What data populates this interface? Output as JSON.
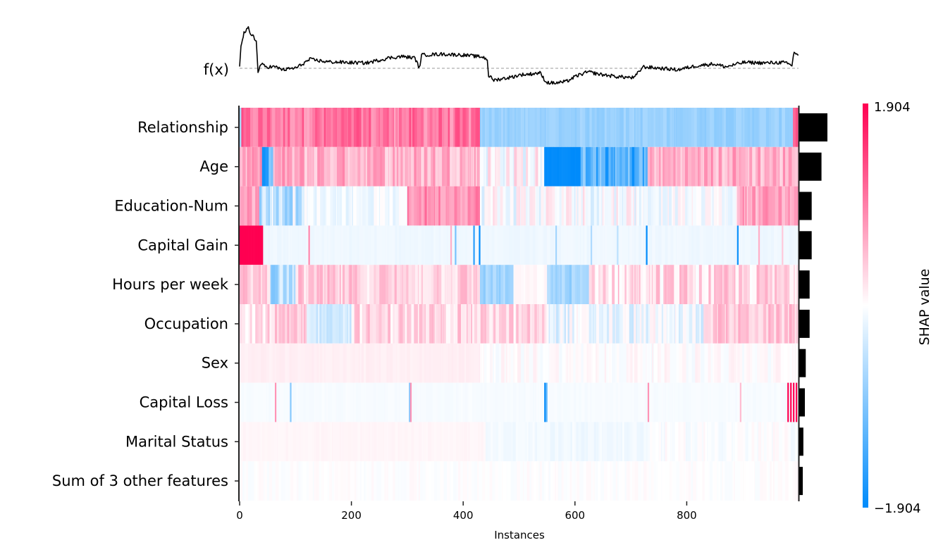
{
  "chart_data": {
    "type": "heatmap",
    "title": "",
    "xlabel": "Instances",
    "ylabel": "",
    "n_instances": 1000,
    "xlim": [
      0,
      1000
    ],
    "x_ticks": [
      0,
      200,
      400,
      600,
      800
    ],
    "fx_label": "f(x)",
    "colorbar": {
      "title": "SHAP value",
      "max_label": "1.904",
      "min_label": "−1.904",
      "vmin": -1.904,
      "vmax": 1.904,
      "low_color": "#008bfb",
      "mid_color": "#ffffff",
      "high_color": "#ff0051"
    },
    "features": [
      {
        "name": "Relationship",
        "mean_abs_shap": 0.95
      },
      {
        "name": "Age",
        "mean_abs_shap": 0.75
      },
      {
        "name": "Education-Num",
        "mean_abs_shap": 0.42
      },
      {
        "name": "Capital Gain",
        "mean_abs_shap": 0.42
      },
      {
        "name": "Hours per week",
        "mean_abs_shap": 0.35
      },
      {
        "name": "Occupation",
        "mean_abs_shap": 0.35
      },
      {
        "name": "Sex",
        "mean_abs_shap": 0.22
      },
      {
        "name": "Capital Loss",
        "mean_abs_shap": 0.19
      },
      {
        "name": "Marital Status",
        "mean_abs_shap": 0.14
      },
      {
        "name": "Sum of 3 other features",
        "mean_abs_shap": 0.12
      }
    ],
    "heatmap_segments": [
      [
        [
          0,
          3,
          -0.6,
          0.1
        ],
        [
          3,
          430,
          1.0,
          0.35
        ],
        [
          430,
          990,
          -0.75,
          0.12
        ],
        [
          990,
          1000,
          1.3,
          0.3
        ]
      ],
      [
        [
          0,
          40,
          0.6,
          0.35
        ],
        [
          40,
          60,
          -1.2,
          0.6
        ],
        [
          60,
          430,
          0.6,
          0.35
        ],
        [
          430,
          545,
          0.05,
          0.4
        ],
        [
          545,
          610,
          -1.9,
          0.05
        ],
        [
          610,
          730,
          -1.3,
          0.6
        ],
        [
          730,
          1000,
          0.6,
          0.35
        ]
      ],
      [
        [
          0,
          35,
          0.7,
          0.3
        ],
        [
          35,
          120,
          -0.4,
          0.5
        ],
        [
          120,
          300,
          -0.1,
          0.15
        ],
        [
          300,
          430,
          0.85,
          0.3
        ],
        [
          430,
          720,
          0.0,
          0.35
        ],
        [
          720,
          890,
          -0.05,
          0.2
        ],
        [
          890,
          1000,
          0.7,
          0.3
        ]
      ],
      [
        [
          0,
          42,
          1.904,
          0.0
        ],
        [
          42,
          1000,
          -0.12,
          0.03
        ]
      ],
      [
        [
          0,
          55,
          0.4,
          0.25
        ],
        [
          55,
          100,
          -0.6,
          0.4
        ],
        [
          100,
          430,
          0.35,
          0.3
        ],
        [
          430,
          490,
          -0.7,
          0.2
        ],
        [
          490,
          550,
          0.05,
          0.05
        ],
        [
          550,
          625,
          -0.7,
          0.2
        ],
        [
          625,
          1000,
          0.3,
          0.35
        ]
      ],
      [
        [
          0,
          120,
          0.3,
          0.3
        ],
        [
          120,
          200,
          -0.3,
          0.2
        ],
        [
          200,
          550,
          0.3,
          0.3
        ],
        [
          550,
          830,
          -0.15,
          0.3
        ],
        [
          830,
          1000,
          0.4,
          0.25
        ]
      ],
      [
        [
          0,
          430,
          0.12,
          0.03
        ],
        [
          430,
          1000,
          0.02,
          0.12
        ]
      ],
      [
        [
          0,
          1000,
          -0.06,
          0.02
        ]
      ],
      [
        [
          0,
          440,
          0.07,
          0.02
        ],
        [
          440,
          730,
          -0.1,
          0.06
        ],
        [
          730,
          1000,
          -0.02,
          0.1
        ]
      ],
      [
        [
          0,
          1000,
          0.0,
          0.06
        ]
      ]
    ],
    "heatmap_spikes": [
      [],
      [],
      [],
      [
        [
          123,
          0.9
        ],
        [
          377,
          0.6
        ],
        [
          385,
          -1.0
        ],
        [
          418,
          -1.6
        ],
        [
          428,
          -1.9
        ],
        [
          565,
          -0.7
        ],
        [
          628,
          -0.6
        ],
        [
          675,
          -0.5
        ],
        [
          727,
          -1.9
        ],
        [
          890,
          -1.8
        ],
        [
          928,
          0.6
        ],
        [
          970,
          0.4
        ]
      ],
      [],
      [],
      [],
      [
        [
          63,
          0.8
        ],
        [
          90,
          -0.9
        ],
        [
          303,
          -1.0
        ],
        [
          305,
          0.8
        ],
        [
          545,
          -1.9
        ],
        [
          548,
          -1.2
        ],
        [
          730,
          0.8
        ],
        [
          895,
          0.5
        ],
        [
          980,
          1.904
        ],
        [
          985,
          1.904
        ],
        [
          990,
          1.904
        ],
        [
          995,
          1.904
        ]
      ],
      [],
      []
    ],
    "fx_curve": {
      "baseline": 0.0,
      "points": [
        [
          0,
          0.05
        ],
        [
          3,
          0.8
        ],
        [
          10,
          1.2
        ],
        [
          20,
          1.35
        ],
        [
          25,
          1.1
        ],
        [
          30,
          1.15
        ],
        [
          38,
          0.9
        ],
        [
          42,
          -0.15
        ],
        [
          48,
          0.15
        ],
        [
          60,
          0.05
        ],
        [
          80,
          0.05
        ],
        [
          100,
          -0.05
        ],
        [
          130,
          0.02
        ],
        [
          160,
          0.3
        ],
        [
          200,
          0.22
        ],
        [
          240,
          0.2
        ],
        [
          290,
          0.18
        ],
        [
          340,
          0.35
        ],
        [
          370,
          0.4
        ],
        [
          400,
          0.35
        ],
        [
          410,
          0.0
        ],
        [
          415,
          0.45
        ],
        [
          460,
          0.48
        ],
        [
          510,
          0.45
        ],
        [
          555,
          0.38
        ],
        [
          565,
          0.3
        ],
        [
          568,
          -0.25
        ],
        [
          580,
          -0.4
        ],
        [
          620,
          -0.3
        ],
        [
          640,
          -0.22
        ],
        [
          660,
          -0.2
        ],
        [
          685,
          -0.15
        ],
        [
          700,
          -0.48
        ],
        [
          720,
          -0.5
        ],
        [
          745,
          -0.45
        ],
        [
          770,
          -0.25
        ],
        [
          795,
          -0.12
        ],
        [
          820,
          -0.2
        ],
        [
          860,
          -0.28
        ],
        [
          900,
          -0.32
        ],
        [
          920,
          0.05
        ],
        [
          960,
          0.0
        ],
        [
          1000,
          -0.05
        ],
        [
          1040,
          0.08
        ],
        [
          1080,
          0.15
        ],
        [
          1110,
          0.05
        ],
        [
          1150,
          0.2
        ],
        [
          1200,
          0.18
        ],
        [
          1240,
          0.2
        ],
        [
          1260,
          0.1
        ],
        [
          1265,
          0.55
        ],
        [
          1275,
          0.45
        ]
      ]
    }
  }
}
